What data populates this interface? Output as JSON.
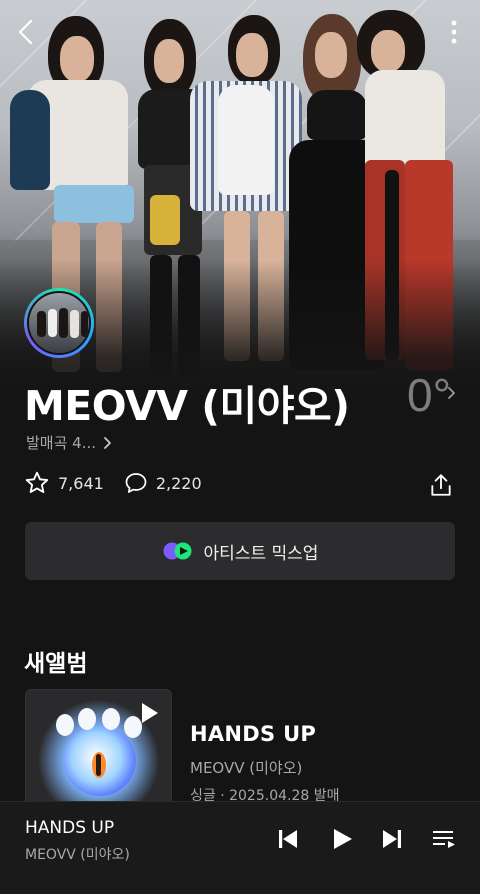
{
  "artist": {
    "name": "MEOVV (미야오)",
    "degree": "0°",
    "subtitle": "발매곡 4..."
  },
  "stats": {
    "likes": "7,641",
    "comments": "2,220"
  },
  "mix_button": {
    "label": "아티스트 믹스업"
  },
  "new_album_section": {
    "title": "새앨범"
  },
  "album": {
    "title": "HANDS UP",
    "artist": "MEOVV (미야오)",
    "meta": "싱글 · 2025.04.28 발매"
  },
  "now_playing": {
    "title": "HANDS UP",
    "artist": "MEOVV (미야오)"
  },
  "icons": {
    "back": "chevron-left-icon",
    "more": "more-vertical-icon",
    "star": "star-icon",
    "comment": "comment-icon",
    "share": "share-icon",
    "mix": "mix-logo-icon",
    "play": "play-icon",
    "prev": "skip-previous-icon",
    "next": "skip-next-icon",
    "playlist": "playlist-icon"
  },
  "colors": {
    "background": "#141414",
    "mix_green": "#1ee67a",
    "mix_purple": "#7a5cff",
    "avatar_ring": "#1ee6a5"
  }
}
